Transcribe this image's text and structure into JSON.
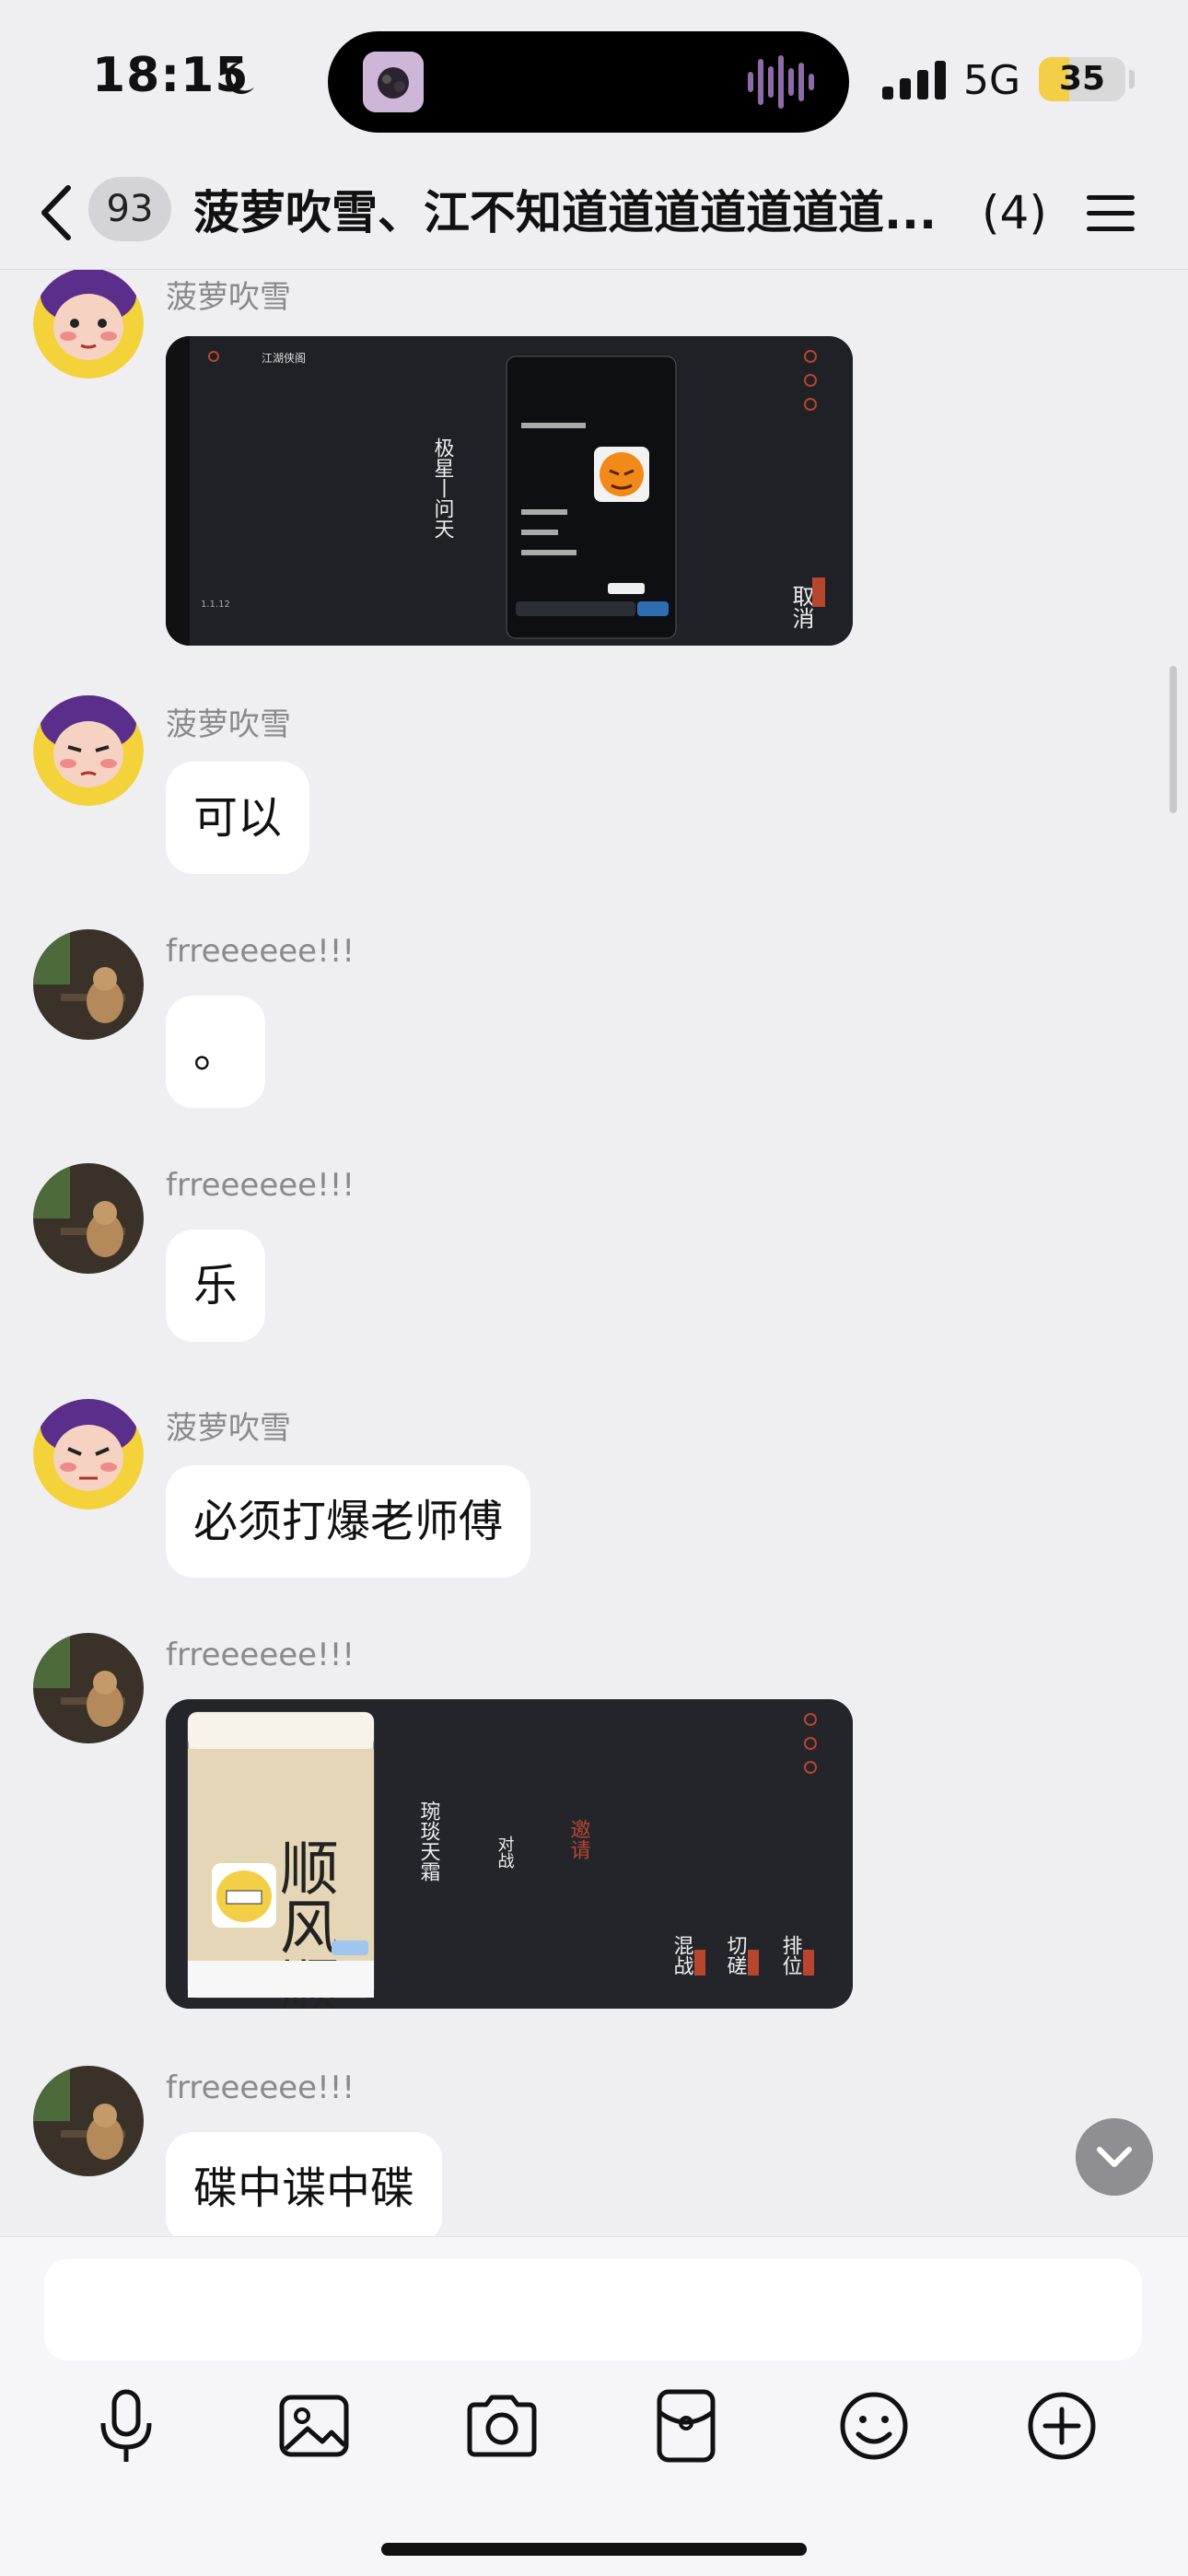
{
  "status": {
    "time": "18:15",
    "network": "5G",
    "battery": "35",
    "battery_level": 0.35
  },
  "nav": {
    "unread_count": "93",
    "title": "菠萝吹雪、江不知道道道道道道道...",
    "member_count": "(4)"
  },
  "messages": [
    {
      "sender": "菠萝吹雪",
      "type": "image",
      "image_text": [
        "江湖侠阁",
        "极星丨问天",
        "取消",
        "1.1.12"
      ]
    },
    {
      "sender": "菠萝吹雪",
      "type": "text",
      "text": "可以"
    },
    {
      "sender": "frreeeeee!!!",
      "type": "text",
      "text": "。"
    },
    {
      "sender": "frreeeeee!!!",
      "type": "text",
      "text": "乐"
    },
    {
      "sender": "菠萝吹雪",
      "type": "text",
      "text": "必须打爆老师傅"
    },
    {
      "sender": "frreeeeee!!!",
      "type": "image",
      "image_text": [
        "琬琰天霜",
        "对战",
        "邀请",
        "混战",
        "切磋",
        "排位",
        "顺风顺"
      ]
    },
    {
      "sender": "frreeeeee!!!",
      "type": "text",
      "text": "碟中谍中碟"
    }
  ],
  "icons": [
    "back-icon",
    "menu-icon",
    "microphone-icon",
    "image-icon",
    "camera-icon",
    "red-packet-icon",
    "emoji-icon",
    "plus-icon",
    "chevron-down-icon"
  ],
  "colors": {
    "background": "#efeff2",
    "bubble": "#ffffff",
    "accent_seal": "#b8452e",
    "battery": "#f2cf46"
  }
}
